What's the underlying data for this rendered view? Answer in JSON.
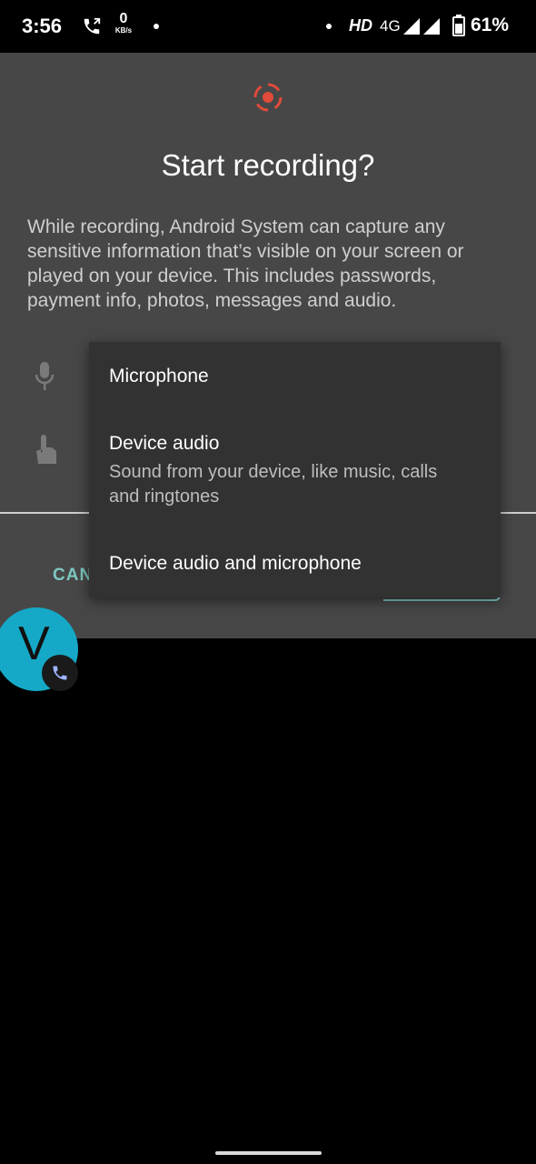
{
  "status_bar": {
    "time": "3:56",
    "speed_value": "0",
    "speed_unit": "KB/s",
    "hd": "HD",
    "network": "4G",
    "battery": "61%"
  },
  "dialog": {
    "title": "Start recording?",
    "description": "While recording, Android System can capture any sensitive information that’s visible on your screen or played on your device. This includes passwords, payment info, photos, messages and audio.",
    "cancel_label": "CAN"
  },
  "audio_menu": {
    "items": [
      {
        "label": "Microphone"
      },
      {
        "label": "Device audio",
        "subtitle": "Sound from your device, like music, calls and ringtones"
      },
      {
        "label": "Device audio and microphone"
      }
    ]
  },
  "bubble": {
    "letter": "V"
  },
  "colors": {
    "accent": "#7ec8c2",
    "record_red": "#e14b3b",
    "dialog_bg": "#474747",
    "menu_bg": "#323232",
    "bubble": "#15a9c7"
  },
  "icons": [
    "phone-call-icon",
    "screen-record-icon",
    "microphone-icon",
    "touch-icon",
    "signal-icon",
    "battery-icon"
  ]
}
